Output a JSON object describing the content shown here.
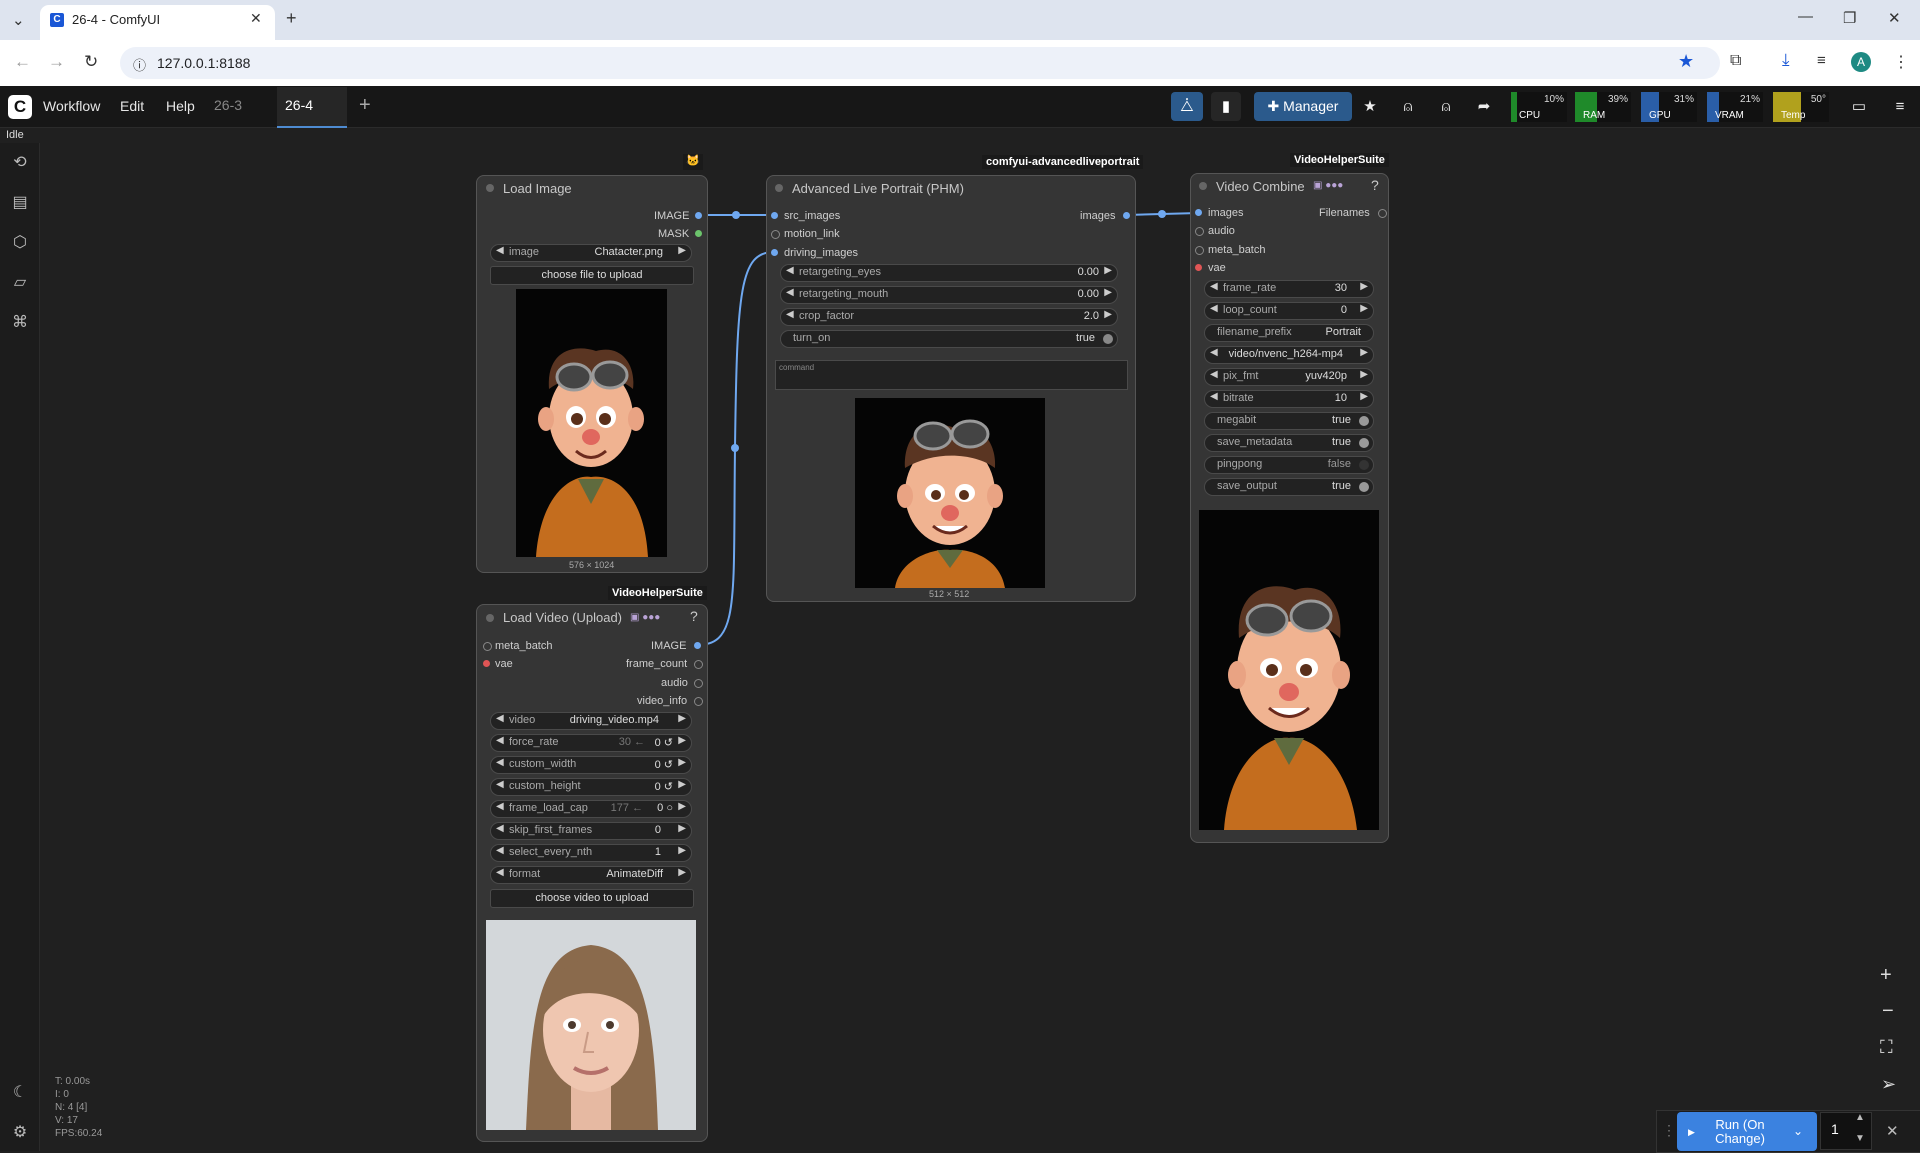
{
  "browser": {
    "tab_title": "26-4 - ComfyUI",
    "url": "127.0.0.1:8188",
    "favicon": "C",
    "profile_initial": "A"
  },
  "menu": {
    "workflow": "Workflow",
    "edit": "Edit",
    "help": "Help"
  },
  "workflow_tabs": [
    "26-3",
    "26-4"
  ],
  "status": "Idle",
  "manager_label": "Manager",
  "monitors": [
    {
      "label": "CPU",
      "value": "10%",
      "color": "#1f8a2a"
    },
    {
      "label": "RAM",
      "value": "39%",
      "color": "#1f8a2a"
    },
    {
      "label": "GPU",
      "value": "31%",
      "color": "#2a5ea8"
    },
    {
      "label": "VRAM",
      "value": "21%",
      "color": "#2a5ea8"
    },
    {
      "label": "Temp",
      "value": "50°",
      "color": "#b1a11d"
    }
  ],
  "groups": {
    "top_icon": "🐱",
    "alp": "comfyui-advancedliveportrait",
    "vhs1": "VideoHelperSuite",
    "vhs2": "VideoHelperSuite"
  },
  "load_image": {
    "title": "Load Image",
    "out_image": "IMAGE",
    "out_mask": "MASK",
    "image_label": "image",
    "image_value": "Chatacter.png",
    "upload": "choose file to upload",
    "dims": "576 × 1024"
  },
  "alp": {
    "title": "Advanced Live Portrait (PHM)",
    "in_src": "src_images",
    "in_motion": "motion_link",
    "in_driving": "driving_images",
    "out_images": "images",
    "w1_label": "retargeting_eyes",
    "w1_value": "0.00",
    "w2_label": "retargeting_mouth",
    "w2_value": "0.00",
    "w3_label": "crop_factor",
    "w3_value": "2.0",
    "w4_label": "turn_on",
    "w4_value": "true",
    "command_placeholder": "command",
    "dims": "512 × 512"
  },
  "video_combine": {
    "title": "Video Combine",
    "in_images": "images",
    "in_audio": "audio",
    "in_meta": "meta_batch",
    "in_vae": "vae",
    "out_filenames": "Filenames",
    "widgets": [
      {
        "label": "frame_rate",
        "value": "30"
      },
      {
        "label": "loop_count",
        "value": "0"
      },
      {
        "label": "filename_prefix",
        "value": "Portrait"
      },
      {
        "label": "",
        "value": "video/nvenc_h264-mp4"
      },
      {
        "label": "pix_fmt",
        "value": "yuv420p"
      },
      {
        "label": "bitrate",
        "value": "10"
      },
      {
        "label": "megabit",
        "value": "true"
      },
      {
        "label": "save_metadata",
        "value": "true"
      },
      {
        "label": "pingpong",
        "value": "false"
      },
      {
        "label": "save_output",
        "value": "true"
      }
    ]
  },
  "load_video": {
    "title": "Load Video (Upload)",
    "in_meta": "meta_batch",
    "in_vae": "vae",
    "out_image": "IMAGE",
    "out_frame_count": "frame_count",
    "out_audio": "audio",
    "out_video_info": "video_info",
    "widgets": [
      {
        "label": "video",
        "value": "driving_video.mp4",
        "hint": ""
      },
      {
        "label": "force_rate",
        "value": "0 ↺",
        "hint": "30 ←"
      },
      {
        "label": "custom_width",
        "value": "0 ↺",
        "hint": ""
      },
      {
        "label": "custom_height",
        "value": "0 ↺",
        "hint": ""
      },
      {
        "label": "frame_load_cap",
        "value": "0 ○",
        "hint": "177 ←"
      },
      {
        "label": "skip_first_frames",
        "value": "0",
        "hint": ""
      },
      {
        "label": "select_every_nth",
        "value": "1",
        "hint": ""
      },
      {
        "label": "format",
        "value": "AnimateDiff",
        "hint": ""
      }
    ],
    "upload": "choose video to upload"
  },
  "stats": {
    "t": "T: 0.00s",
    "i": "I: 0",
    "n": "N: 4 [4]",
    "v": "V: 17",
    "fps": "FPS:60.24"
  },
  "run": {
    "label": "Run (On Change)",
    "count": "1"
  }
}
